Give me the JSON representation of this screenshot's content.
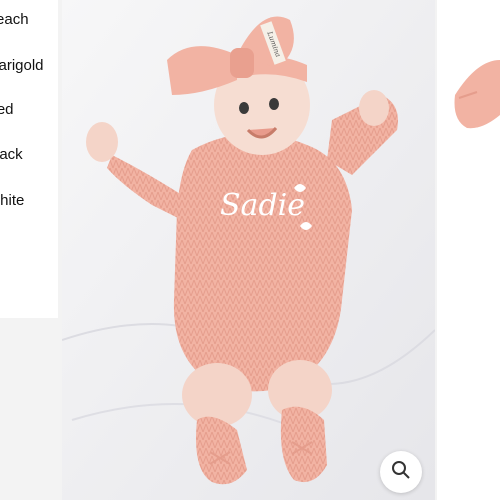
{
  "color_options": [
    "Peach",
    "Marigold",
    "Red",
    "Black",
    "White"
  ],
  "product_image": {
    "name_embroidery": "Sadie",
    "headband_label": "Lumina"
  },
  "zoom": {
    "icon": "search-icon"
  },
  "colors": {
    "peach": "#f2b3a3",
    "background": "#f3f3f3",
    "text": "#111111"
  }
}
